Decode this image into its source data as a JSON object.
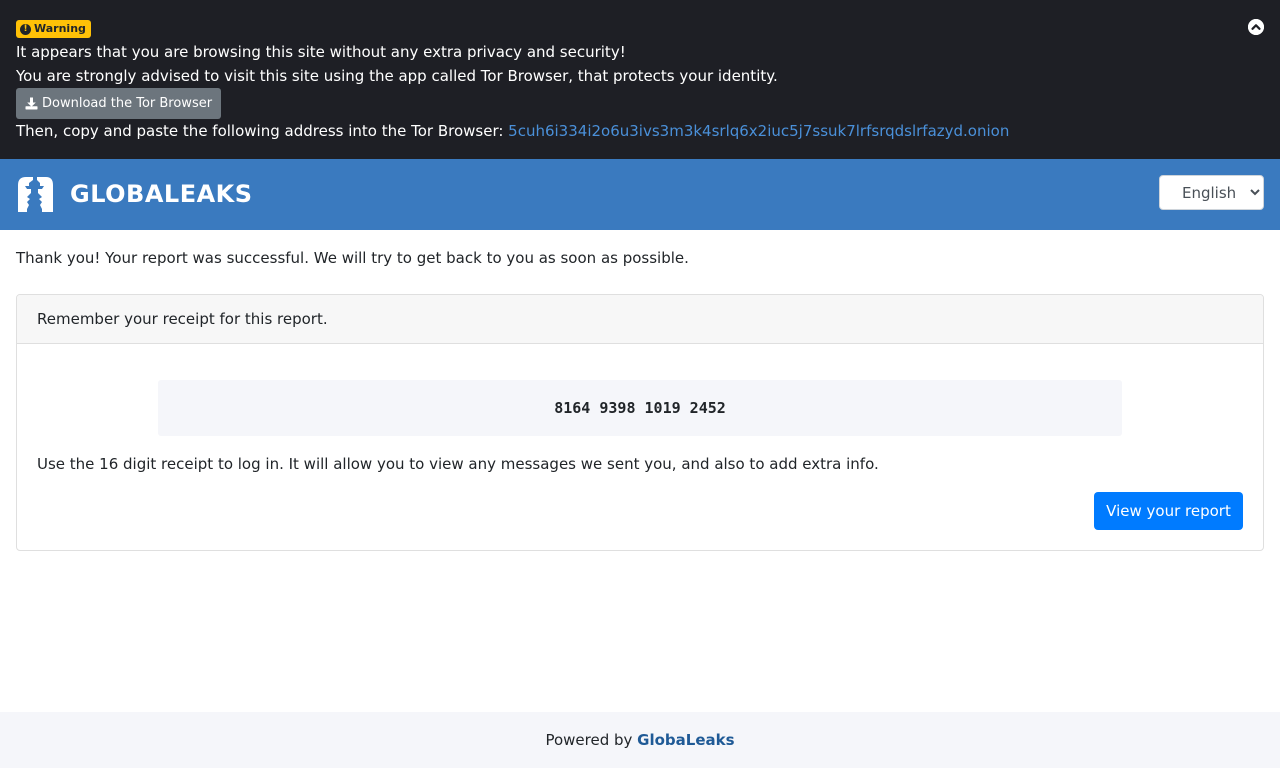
{
  "warning": {
    "badge_label": "Warning",
    "line1": "It appears that you are browsing this site without any extra privacy and security!",
    "line2": "You are strongly advised to visit this site using the app called Tor Browser, that protects your identity.",
    "download_label": "Download the Tor Browser",
    "copy_prefix": "Then, copy and paste the following address into the Tor Browser: ",
    "onion_address": "5cuh6i334i2o6u3ivs3m3k4srlq6x2iuc5j7ssuk7lrfsrqdslrfazyd.onion",
    "badge_color": "#ffc107"
  },
  "header": {
    "brand_name": "GLOBALEAKS",
    "language_selected": "English",
    "background_color": "#3a7abf"
  },
  "main": {
    "thank_you": "Thank you! Your report was successful. We will try to get back to you as soon as possible.",
    "card_title": "Remember your receipt for this report.",
    "receipt": "8164 9398 1019 2452",
    "receipt_hint": "Use the 16 digit receipt to log in. It will allow you to view any messages we sent you, and also to add extra info.",
    "view_report_label": "View your report",
    "button_color": "#007bff"
  },
  "footer": {
    "powered_by": "Powered by ",
    "link_label": "GlobaLeaks"
  },
  "icons": {
    "warning_badge": "exclamation-circle-icon",
    "collapse": "chevron-up-circle-icon",
    "download": "download-icon",
    "logo": "globaleaks-logo-icon"
  }
}
